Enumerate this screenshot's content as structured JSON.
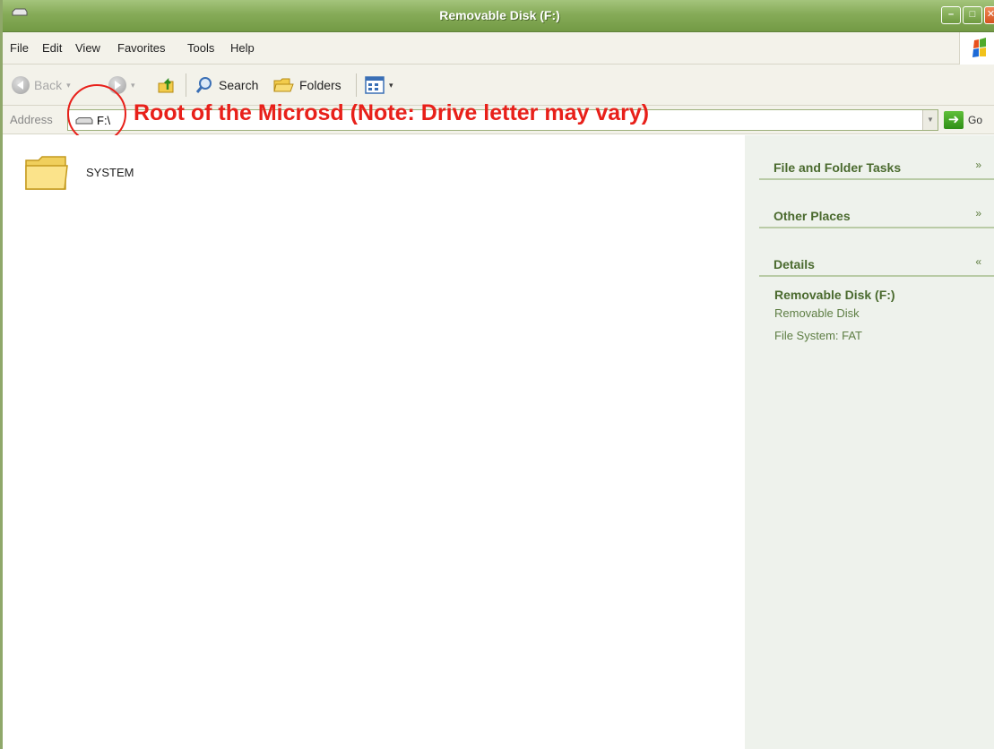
{
  "window": {
    "title": "Removable Disk (F:)",
    "controls": {
      "minimize": "–",
      "maximize": "□",
      "close": "✕"
    }
  },
  "menubar": {
    "items": [
      "File",
      "Edit",
      "View",
      "Favorites",
      "Tools",
      "Help"
    ]
  },
  "toolbar": {
    "back_label": "Back",
    "search_label": "Search",
    "folders_label": "Folders"
  },
  "address": {
    "label": "Address",
    "value": "F:\\",
    "go_label": "Go"
  },
  "annotation": {
    "text": "Root of the Microsd (Note: Drive letter may vary)",
    "color": "#e8201a"
  },
  "content": {
    "items": [
      {
        "name": "SYSTEM",
        "type": "folder"
      }
    ]
  },
  "taskpane": {
    "sections": [
      {
        "title": "File and Folder Tasks",
        "chevron": "»",
        "expanded": false
      },
      {
        "title": "Other Places",
        "chevron": "»",
        "expanded": false
      },
      {
        "title": "Details",
        "chevron": "«",
        "expanded": true
      }
    ],
    "details": {
      "name": "Removable Disk (F:)",
      "type": "Removable Disk",
      "filesystem": "File System: FAT"
    }
  },
  "colors": {
    "titlebar": "#86ab58",
    "taskpane_bg": "#eef2ec",
    "taskpane_heading": "#4a6a2e",
    "annotation": "#e8201a"
  }
}
